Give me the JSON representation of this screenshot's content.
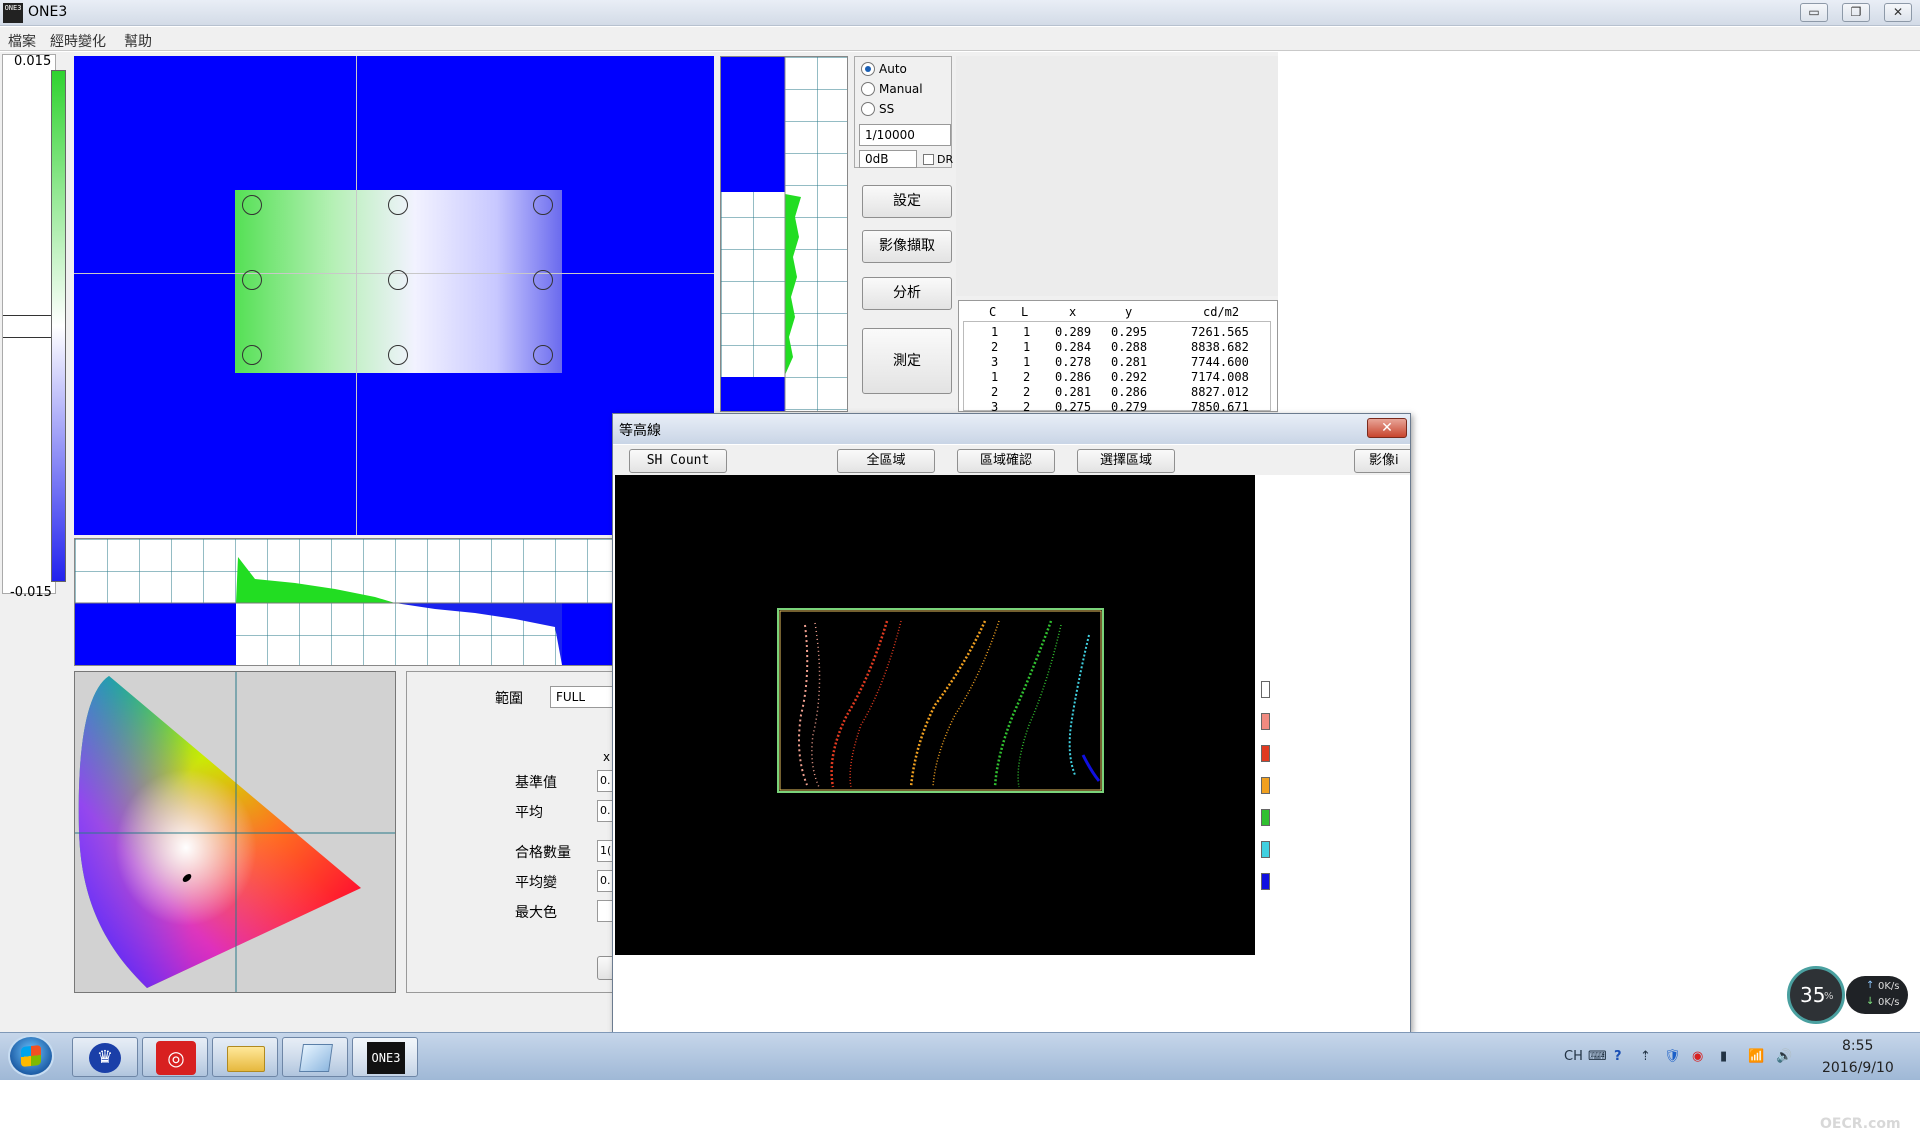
{
  "window": {
    "icon_text": "ONE3",
    "title": "ONE3",
    "minimize": "▭",
    "restore": "❐",
    "close": "✕"
  },
  "menu": [
    "檔案",
    "經時變化",
    "幫助"
  ],
  "scale": {
    "max": "0.015",
    "min": "-0.015"
  },
  "capture_mode": {
    "options": [
      "Auto",
      "Manual",
      "SS"
    ],
    "selected": "Auto",
    "shutter": "1/10000",
    "gain": "0dB",
    "gain_checkbox_label": "DR"
  },
  "buttons": {
    "settings": "設定",
    "capture": "影像擷取",
    "analyze": "分析",
    "measure": "測定"
  },
  "table": {
    "headers": [
      "C",
      "L",
      "x",
      "y",
      "cd/m2"
    ],
    "rows": [
      [
        "1",
        "1",
        "0.289",
        "0.295",
        "7261.565"
      ],
      [
        "2",
        "1",
        "0.284",
        "0.288",
        "8838.682"
      ],
      [
        "3",
        "1",
        "0.278",
        "0.281",
        "7744.600"
      ],
      [
        "1",
        "2",
        "0.286",
        "0.292",
        "7174.008"
      ],
      [
        "2",
        "2",
        "0.281",
        "0.286",
        "8827.012"
      ],
      [
        "3",
        "2",
        "0.275",
        "0.279",
        "7850.671"
      ]
    ]
  },
  "stats": {
    "range_label": "範圍",
    "range_value": "FULL",
    "col_x": "x",
    "labels": [
      "基準值",
      "平均",
      "合格數量",
      "平均變",
      "最大色"
    ],
    "values": [
      "0.",
      "0.",
      "1(",
      "0.",
      ""
    ]
  },
  "contour_dialog": {
    "title": "等高線",
    "close": "✕",
    "buttons": [
      "SH Count",
      "全區域",
      "區域確認",
      "選擇區域",
      "影像i"
    ],
    "legend_colors": [
      "#ffffff",
      "#f08a80",
      "#e03a20",
      "#f0a020",
      "#30c030",
      "#40d0e0",
      "#1010e0"
    ]
  },
  "taskbar": {
    "pinned": [
      "crown-app",
      "netease-music",
      "file-explorer",
      "notepad",
      "ONE3"
    ],
    "one3_label": "ONE3",
    "tray": [
      "CH",
      "⌨",
      "?",
      "⇡",
      "🛡",
      "◉",
      "▮",
      "📶",
      "🔊"
    ],
    "time": "8:55",
    "date": "2016/9/10"
  },
  "net_meter": {
    "percent": "35",
    "percent_unit": "%",
    "up": "0K/s",
    "down": "0K/s"
  },
  "watermark": "OECR.com",
  "colors": {
    "image_blue": "#0000ff",
    "signal_green": "#22dd22",
    "taskbar": "#b3c8e2"
  }
}
